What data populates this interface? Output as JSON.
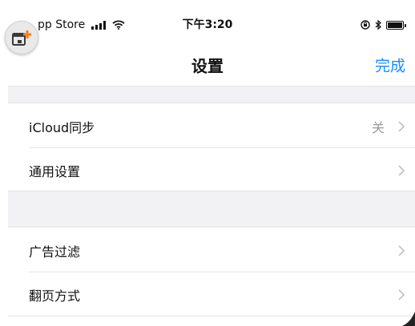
{
  "status_bar": {
    "carrier": "pp Store",
    "time": "下午3:20",
    "icons": [
      "signal-icon",
      "wifi-icon",
      "orientation-lock-icon",
      "bluetooth-icon",
      "battery-icon"
    ]
  },
  "overlay": {
    "icon": "add-to-window-icon",
    "accent_color": "#ff7a1a"
  },
  "nav": {
    "title": "设置",
    "done_label": "完成",
    "accent_color": "#1a8cff"
  },
  "settings": {
    "sections": [
      {
        "rows": [
          {
            "label": "iCloud同步",
            "value": "关",
            "icon": "chevron-right-icon"
          },
          {
            "label": "通用设置",
            "value": "",
            "icon": "chevron-right-icon"
          }
        ]
      },
      {
        "rows": [
          {
            "label": "广告过滤",
            "value": "",
            "icon": "chevron-right-icon"
          },
          {
            "label": "翻页方式",
            "value": "",
            "icon": "chevron-right-icon"
          }
        ]
      }
    ]
  }
}
